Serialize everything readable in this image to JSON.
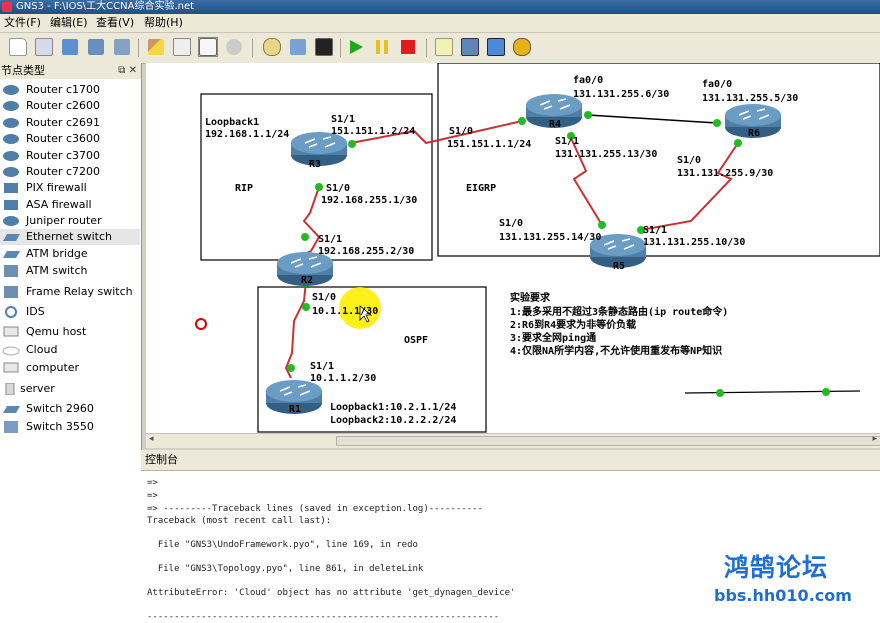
{
  "window": {
    "title": "GNS3 - F:\\IOS\\工大CCNA综合实验.net"
  },
  "menu": [
    "文件(F)",
    "编辑(E)",
    "查看(V)",
    "帮助(H)"
  ],
  "panel": {
    "title": "节点类型",
    "nodes": [
      "Router c1700",
      "Router c2600",
      "Router c2691",
      "Router c3600",
      "Router c3700",
      "Router c7200",
      "PIX firewall",
      "ASA firewall",
      "Juniper router",
      "Ethernet switch",
      "ATM bridge",
      "ATM switch",
      "Frame Relay switch",
      "IDS",
      "Qemu host",
      "Cloud",
      "computer",
      "server",
      "Switch 2960",
      "Switch 3550"
    ]
  },
  "topology": {
    "areas": {
      "rip": "RIP",
      "eigrp": "EIGRP",
      "ospf": "OSPF"
    },
    "routers": {
      "r1": "R1",
      "r2": "R2",
      "r3": "R3",
      "r4": "R4",
      "r5": "R5",
      "r6": "R6"
    },
    "labels": {
      "r3_loopback": "Loopback1",
      "r3_loopback_ip": "192.168.1.1/24",
      "r3_s11": "S1/1",
      "r3_s11_ip": "151.151.1.2/24",
      "r3_s10": "S1/0",
      "r3_s10_ip": "192.168.255.1/30",
      "r2_s11": "S1/1",
      "r2_s11_ip": "192.168.255.2/30",
      "r2_s10": "S1/0",
      "r2_s10_ip": "10.1.1.1/30",
      "r1_s11": "S1/1",
      "r1_s11_ip": "10.1.1.2/30",
      "r1_loopback1": "Loopback1:10.2.1.1/24",
      "r1_loopback2": "Loopback2:10.2.2.2/24",
      "r4_s10": "S1/0",
      "r4_s10_ip": "151.151.1.1/24",
      "r4_fa00": "fa0/0",
      "r4_fa00_ip": "131.131.255.6/30",
      "r4_s11": "S1/1",
      "r4_s11_ip": "131.131.255.13/30",
      "r6_fa00": "fa0/0",
      "r6_fa00_ip": "131.131.255.5/30",
      "r6_s10": "S1/0",
      "r6_s10_ip": "131.131.255.9/30",
      "r5_s10": "S1/0",
      "r5_s10_ip": "131.131.255.14/30",
      "r5_s11": "S1/1",
      "r5_s11_ip": "131.131.255.10/30"
    },
    "requirements": {
      "title": "实验要求",
      "items": [
        "1:最多采用不超过3条静态路由(ip route命令)",
        "2:R6到R4要求为非等价负载",
        "3:要求全网ping通",
        "4:仅限NA所学内容,不允许使用重发布等NP知识"
      ]
    }
  },
  "console": {
    "title": "控制台",
    "lines": [
      "=>",
      "=>",
      "=> ---------Traceback lines (saved in exception.log)----------",
      "Traceback (most recent call last):",
      "  File \"GNS3\\UndoFramework.pyo\", line 169, in redo",
      "  File \"GNS3\\Topology.pyo\", line 861, in deleteLink",
      "AttributeError: 'Cloud' object has no attribute 'get_dynagen_device'",
      "-----------------------------------------------------------------"
    ]
  },
  "watermark": {
    "cn": "鸿鹄论坛",
    "url": "bbs.hh010.com"
  },
  "colors": {
    "serial": "#c83232",
    "ethernet": "#000000",
    "port": "#22bb22",
    "router": "#4f7fa6",
    "highlight": "#ffee00"
  }
}
